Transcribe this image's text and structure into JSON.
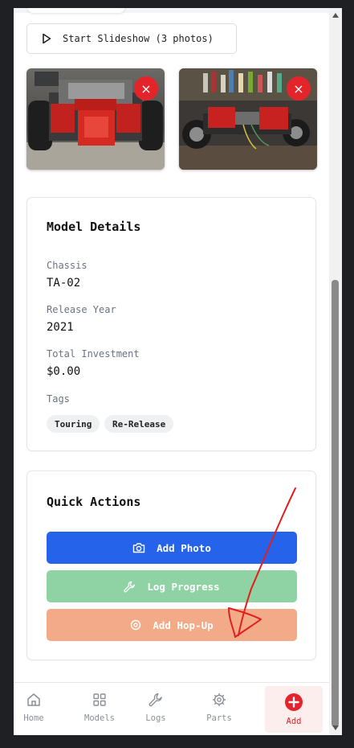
{
  "slideshow": {
    "label": "Start Slideshow (3 photos)"
  },
  "photos": [
    {
      "delete_label": "×"
    },
    {
      "delete_label": "×"
    }
  ],
  "details": {
    "title": "Model Details",
    "fields": [
      {
        "label": "Chassis",
        "value": "TA-02"
      },
      {
        "label": "Release Year",
        "value": "2021"
      },
      {
        "label": "Total Investment",
        "value": "$0.00"
      }
    ],
    "tags_label": "Tags",
    "tags": [
      "Touring",
      "Re-Release"
    ]
  },
  "quick_actions": {
    "title": "Quick Actions",
    "buttons": [
      {
        "label": "Add Photo",
        "color": "#2563eb"
      },
      {
        "label": "Log Progress",
        "color": "#8fd3a5"
      },
      {
        "label": "Add Hop-Up",
        "color": "#f2aa88"
      }
    ]
  },
  "nav": {
    "items": [
      {
        "label": "Home",
        "icon": "home-icon"
      },
      {
        "label": "Models",
        "icon": "grid-icon"
      },
      {
        "label": "Logs",
        "icon": "wrench-icon"
      },
      {
        "label": "Parts",
        "icon": "gear-icon"
      },
      {
        "label": "Add",
        "icon": "plus-circle-icon"
      }
    ]
  },
  "colors": {
    "accent_red": "#e3252b",
    "primary_blue": "#2563eb",
    "annotation_red": "#e02020"
  }
}
